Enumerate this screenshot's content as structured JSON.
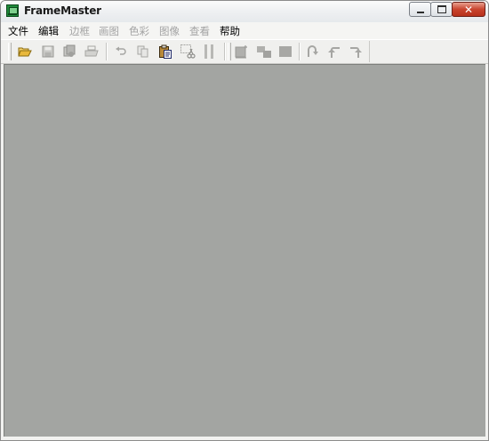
{
  "window": {
    "title": "FrameMaster",
    "controls": {
      "minimize": "minimize",
      "maximize": "maximize",
      "close": "close"
    },
    "close_glyph": "✕"
  },
  "menu": [
    {
      "label": "文件",
      "enabled": true
    },
    {
      "label": "编辑",
      "enabled": true
    },
    {
      "label": "边框",
      "enabled": false
    },
    {
      "label": "画图",
      "enabled": false
    },
    {
      "label": "色彩",
      "enabled": false
    },
    {
      "label": "图像",
      "enabled": false
    },
    {
      "label": "查看",
      "enabled": false
    },
    {
      "label": "帮助",
      "enabled": true
    }
  ],
  "toolbar": {
    "tools": [
      {
        "icon": "open-folder-icon",
        "enabled": true
      },
      {
        "icon": "save-icon",
        "enabled": false
      },
      {
        "icon": "batch-icon",
        "enabled": false
      },
      {
        "icon": "print-icon",
        "enabled": false
      },
      {
        "icon": "undo-icon",
        "enabled": false
      },
      {
        "icon": "copy-icon",
        "enabled": false
      },
      {
        "icon": "paste-icon",
        "enabled": true
      },
      {
        "icon": "crop-cut-icon",
        "enabled": false
      },
      {
        "icon": "split-icon",
        "enabled": false
      },
      {
        "icon": "frame-in-icon",
        "enabled": false
      },
      {
        "icon": "frame-offset-icon",
        "enabled": false
      },
      {
        "icon": "frame-fill-icon",
        "enabled": false
      },
      {
        "icon": "rotate-180-icon",
        "enabled": false
      },
      {
        "icon": "rotate-left-icon",
        "enabled": false
      },
      {
        "icon": "rotate-right-icon",
        "enabled": false
      }
    ]
  },
  "colors": {
    "canvas": "#a3a5a2",
    "disabled_text": "#a3a3a3",
    "close_button": "#c9442e"
  }
}
